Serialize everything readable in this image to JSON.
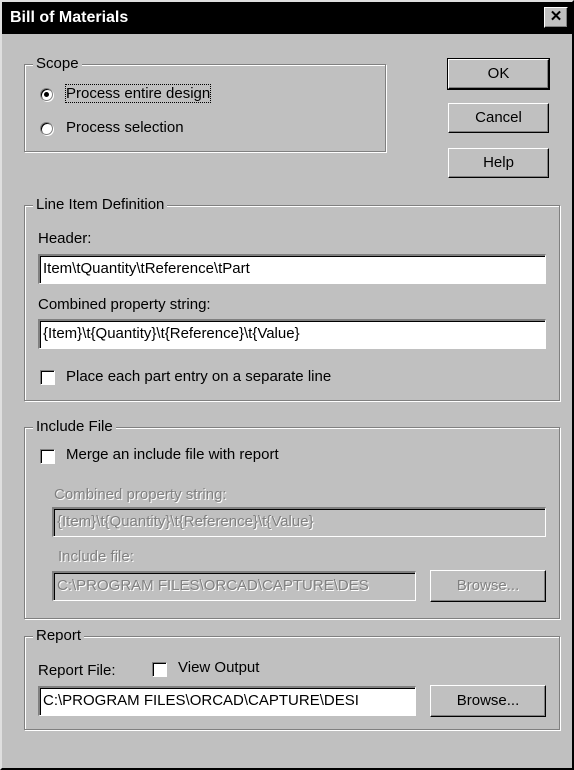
{
  "window": {
    "title": "Bill of Materials",
    "close_glyph": "✕"
  },
  "buttons": {
    "ok": "OK",
    "cancel": "Cancel",
    "help": "Help"
  },
  "scope": {
    "label": "Scope",
    "options": [
      {
        "label": "Process entire design",
        "selected": true
      },
      {
        "label": "Process selection",
        "selected": false
      }
    ]
  },
  "line_item": {
    "label": "Line Item Definition",
    "header_label": "Header:",
    "header_value": "Item\\tQuantity\\tReference\\tPart",
    "combined_label": "Combined property string:",
    "combined_value": "{Item}\\t{Quantity}\\t{Reference}\\t{Value}",
    "separate_line_label": "Place each part entry on a separate line",
    "separate_line_checked": false
  },
  "include_file": {
    "label": "Include File",
    "merge_label": "Merge an include file with report",
    "merge_checked": false,
    "combined_label": "Combined property string:",
    "combined_value": "{Item}\\t{Quantity}\\t{Reference}\\t{Value}",
    "include_label": "Include file:",
    "include_value": "C:\\PROGRAM FILES\\ORCAD\\CAPTURE\\DES",
    "browse_label": "Browse..."
  },
  "report": {
    "label": "Report",
    "file_label": "Report File:",
    "view_output_label": "View Output",
    "view_output_checked": false,
    "file_value": "C:\\PROGRAM FILES\\ORCAD\\CAPTURE\\DESI",
    "browse_label": "Browse..."
  }
}
